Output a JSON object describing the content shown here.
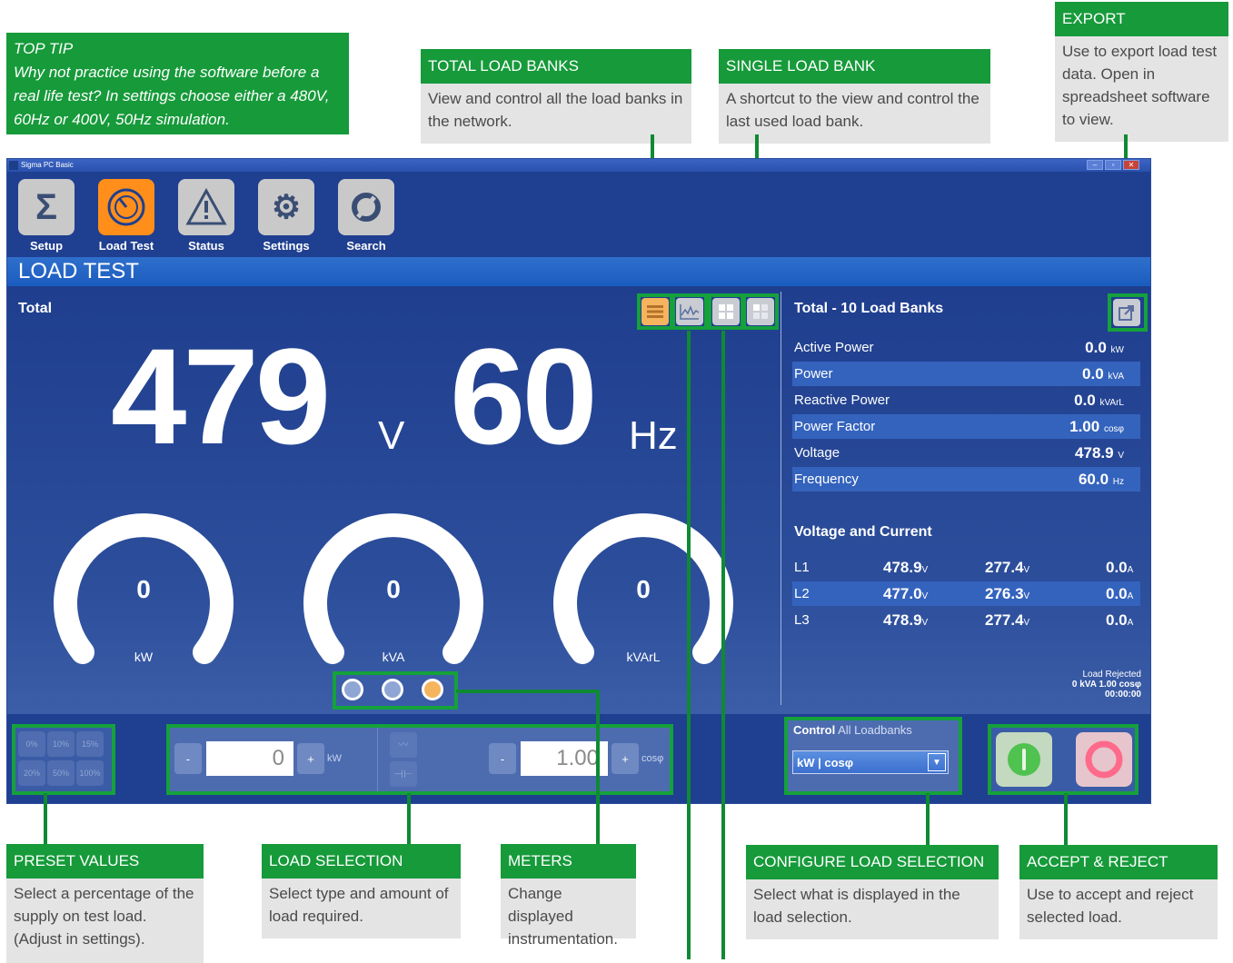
{
  "callouts": {
    "tip": {
      "title": "TOP TIP",
      "text": "Why not practice using the software before a real life test? In settings choose either a 480V, 60Hz or 400V, 50Hz simulation."
    },
    "total_load_banks": {
      "title": "TOTAL LOAD BANKS",
      "text": "View and control all the load banks in the network."
    },
    "single_load_bank": {
      "title": "SINGLE LOAD BANK",
      "text": "A shortcut to the view and control the last used load bank."
    },
    "export": {
      "title": "EXPORT",
      "text": "Use to export load test data. Open in spreadsheet software to view."
    },
    "preset_values": {
      "title": "PRESET VALUES",
      "text": "Select a percentage of the supply on test load. (Adjust in settings)."
    },
    "load_selection": {
      "title": "LOAD SELECTION",
      "text": "Select type and amount of load required."
    },
    "meters": {
      "title": "METERS",
      "text": "Change displayed instrumentation."
    },
    "configure": {
      "title": "CONFIGURE LOAD SELECTION",
      "text": "Select what is displayed in the load selection."
    },
    "accept_reject": {
      "title": "ACCEPT & REJECT",
      "text": "Use to accept and reject selected load."
    }
  },
  "window": {
    "title": "Sigma PC Basic"
  },
  "toolbar": {
    "setup": "Setup",
    "load_test": "Load Test",
    "status": "Status",
    "settings": "Settings",
    "search": "Search"
  },
  "page": {
    "banner": "LOAD TEST",
    "section": "Total"
  },
  "readout": {
    "voltage": "479",
    "voltage_unit": "V",
    "frequency": "60",
    "frequency_unit": "Hz"
  },
  "gauges": [
    {
      "value": "0",
      "unit": "kW"
    },
    {
      "value": "0",
      "unit": "kVA"
    },
    {
      "value": "0",
      "unit": "kVArL"
    }
  ],
  "side": {
    "title": "Total - 10 Load Banks",
    "rows": [
      {
        "label": "Active Power",
        "value": "0.0",
        "unit": "kW"
      },
      {
        "label": "Power",
        "value": "0.0",
        "unit": "kVA"
      },
      {
        "label": "Reactive Power",
        "value": "0.0",
        "unit": "kVArL"
      },
      {
        "label": "Power Factor",
        "value": "1.00",
        "unit": "cosφ"
      },
      {
        "label": "Voltage",
        "value": "478.9",
        "unit": "V"
      },
      {
        "label": "Frequency",
        "value": "60.0",
        "unit": "Hz"
      }
    ],
    "vc_title": "Voltage and Current",
    "vc_rows": [
      {
        "phase": "L1",
        "v1": "478.9",
        "v2": "277.4",
        "a": "0.0"
      },
      {
        "phase": "L2",
        "v1": "477.0",
        "v2": "276.3",
        "a": "0.0"
      },
      {
        "phase": "L3",
        "v1": "478.9",
        "v2": "277.4",
        "a": "0.0"
      }
    ],
    "unit_v": "V",
    "unit_a": "A",
    "rejected": {
      "line1": "Load Rejected",
      "line2": "0 kVA 1.00 cosφ",
      "line3": "00:00:00"
    }
  },
  "presets": [
    "0%",
    "10%",
    "15%",
    "20%",
    "50%",
    "100%"
  ],
  "load": {
    "minus": "-",
    "plus": "+",
    "kw_value": "0",
    "kw_unit": "kW",
    "pf_value": "1.00",
    "pf_unit": "cosφ"
  },
  "control": {
    "label": "Control",
    "scope": "All Loadbanks",
    "selected": "kW | cosφ",
    "arrow": "▼"
  },
  "colors": {
    "accent_green": "#169a3a",
    "window_blue": "#1f3f90",
    "active_orange": "#ff8f1a"
  }
}
